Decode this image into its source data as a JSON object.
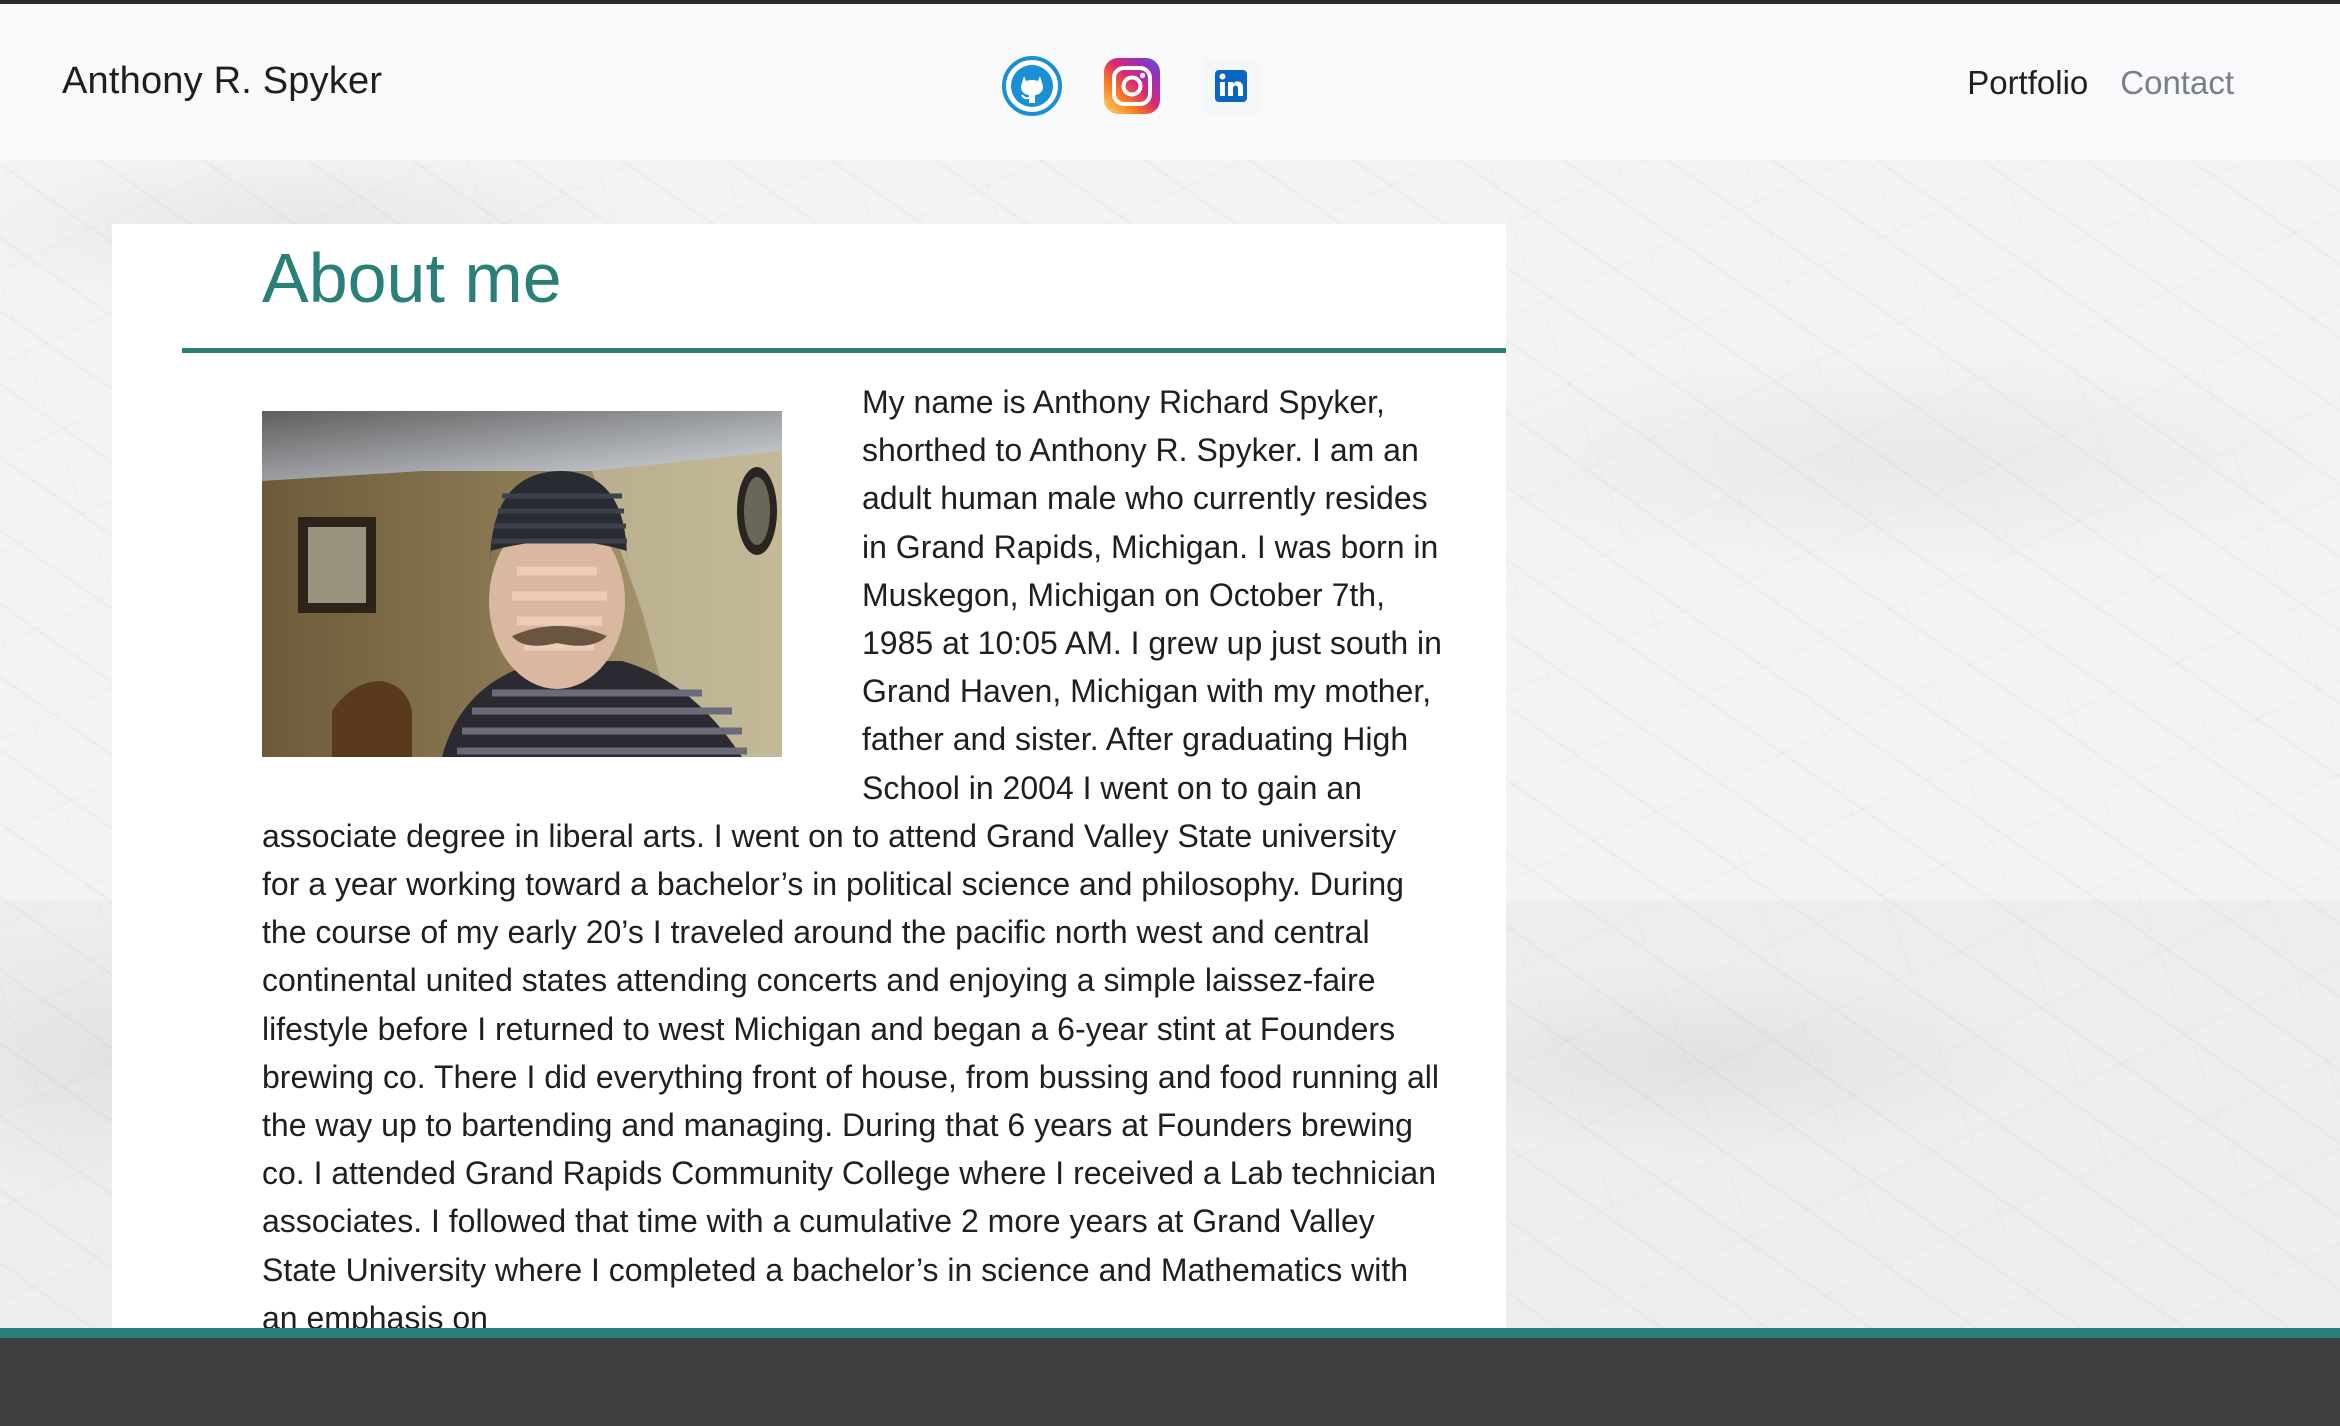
{
  "navbar": {
    "brand": "Anthony R. Spyker",
    "social": [
      {
        "name": "github",
        "icon": "github-icon",
        "color": "#1b8fd6"
      },
      {
        "name": "instagram",
        "icon": "instagram-icon",
        "color": "#c13584"
      },
      {
        "name": "linkedin",
        "icon": "linkedin-icon",
        "color": "#0a66c2"
      }
    ],
    "links": [
      {
        "label": "Portfolio",
        "active": true
      },
      {
        "label": "Contact",
        "active": false
      }
    ]
  },
  "about": {
    "heading": "About me",
    "photo_icon": "profile-photo",
    "paragraph": "My name is Anthony Richard Spyker, shorthed to Anthony R. Spyker. I am an adult human male who currently resides in Grand Rapids, Michigan. I was born in Muskegon, Michigan on October 7th, 1985 at 10:05 AM. I grew up just south in Grand Haven, Michigan with my mother, father and sister. After graduating High School in 2004 I went on to gain an associate degree in liberal arts. I went on to attend Grand Valley State university for a year working toward a bachelor’s in political science and philosophy. During the course of my early 20’s I traveled around the pacific north west and central continental united states attending concerts and enjoying a simple laissez-faire lifestyle before I returned to west Michigan and began a 6-year stint at Founders brewing co. There I did everything front of house, from bussing and food running all the way up to bartending and managing. During that 6 years at Founders brewing co. I attended Grand Rapids Community College where I received a Lab technician associates. I followed that time with a cumulative 2 more years at Grand Valley State University where I completed a bachelor’s in science and Mathematics with an emphasis on"
  },
  "colors": {
    "accent": "#2a8078",
    "navbar_bg": "#f8f9fa",
    "footer_bg": "#3f3e40"
  }
}
